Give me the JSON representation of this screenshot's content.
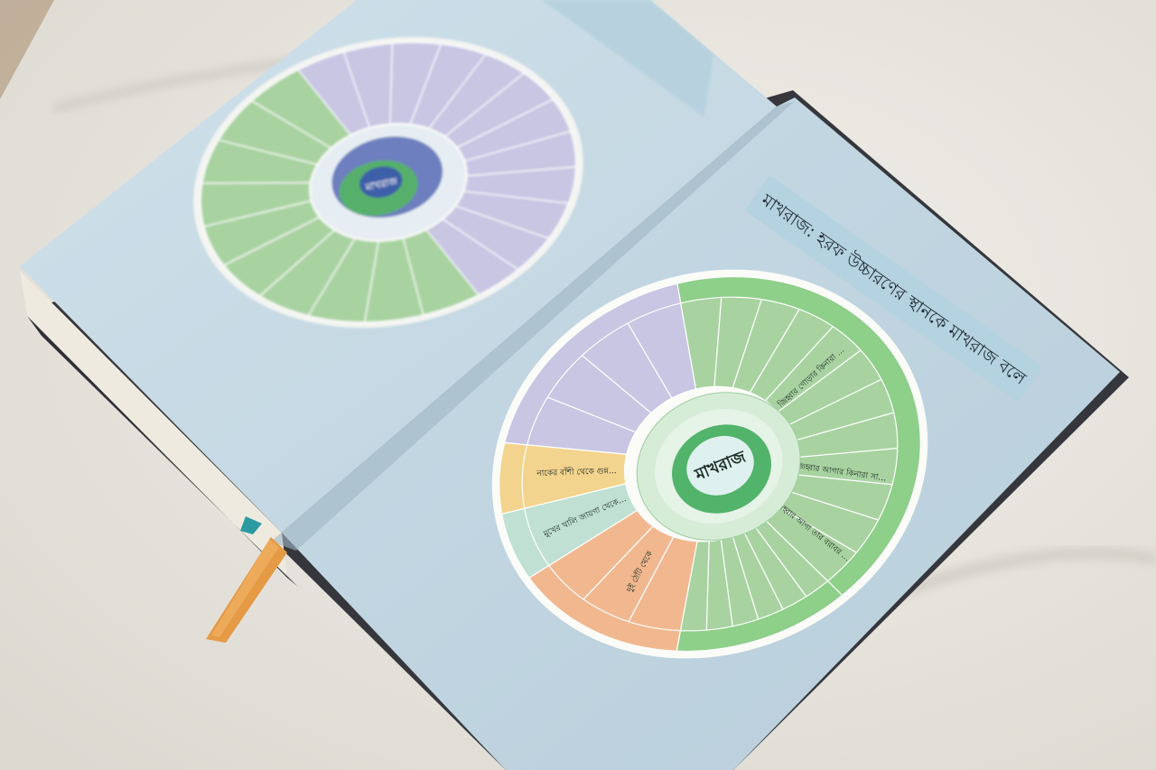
{
  "photo": {
    "subject": "open book with two circular Bengali makhraj diagrams",
    "colors": {
      "background": "#e9e7e0",
      "cover": "#3c3d42",
      "page": "#c9dbe6",
      "title_band": "#b7d3e0",
      "ribbon": "#e59a45",
      "green_segment": "#a8d3a0",
      "lavender_segment": "#c8c6e3",
      "peach_segment": "#f1b890",
      "yellow_segment": "#f3d48e",
      "mint_segment": "#bfe0d2",
      "center_green": "#52b36b"
    }
  },
  "right_page": {
    "heading": "মাখরাজ: হরফ উচ্চারণের স্থানকে মাখরাজ বলে",
    "wheel": {
      "center_label": "মাখরাজ",
      "segments": [
        {
          "text": "জিহ্বার গোড়ার কিনারা উপরের মাড়ীর দাঁতের গোড়ার সঙ্গে লাগিয়ে",
          "color": "green"
        },
        {
          "text": "জিহ্বার আগার কিনারা সামনের উপরের দাঁতের মাড়ীর সঙ্গে লাগিয়ে",
          "color": "green"
        },
        {
          "text": "জিহ্বার আগা তার বরাবর উপরের তালুর সঙ্গে লাগিয়ে",
          "color": "green"
        },
        {
          "text": "দুই ঠোঁট থেকে",
          "color": "peach"
        },
        {
          "text": "মুখের খালি জায়গা থেকে মদের হরফ পড়া যায়",
          "color": "mint"
        },
        {
          "text": "নাকের বাঁশী থেকে গুন্নাহ উচ্চারিত হয়",
          "color": "yellow"
        }
      ]
    }
  },
  "left_page": {
    "wheel": {
      "center_label": "মাখরাজ"
    }
  }
}
